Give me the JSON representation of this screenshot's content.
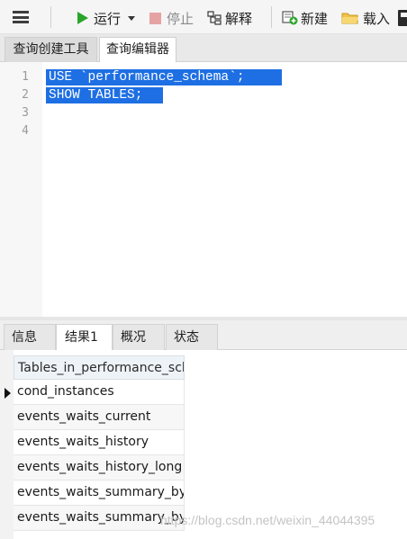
{
  "toolbar": {
    "menu_icon": "hamburger-menu-icon",
    "run_label": "运行",
    "stop_label": "停止",
    "explain_label": "解释",
    "new_label": "新建",
    "load_label": "载入"
  },
  "top_tabs": [
    {
      "label": "查询创建工具",
      "active": false
    },
    {
      "label": "查询编辑器",
      "active": true
    }
  ],
  "editor": {
    "line_numbers": [
      "1",
      "2",
      "3",
      "4"
    ],
    "lines": [
      "USE `performance_schema`;",
      "SHOW TABLES;"
    ],
    "selection_color": "#1e6fe3"
  },
  "result_tabs": [
    {
      "label": "信息",
      "active": false
    },
    {
      "label": "结果1",
      "active": true
    },
    {
      "label": "概况",
      "active": false
    },
    {
      "label": "状态",
      "active": false
    }
  ],
  "grid": {
    "column_header": "Tables_in_performance_schema",
    "rows": [
      "cond_instances",
      "events_waits_current",
      "events_waits_history",
      "events_waits_history_long",
      "events_waits_summary_by",
      "events_waits_summary_by"
    ],
    "selected_row": 0
  },
  "watermark": "https://blog.csdn.net/weixin_44044395",
  "colors": {
    "run_green": "#2aa52a",
    "stop_red": "#e6a3a3",
    "header_bg": "#eef3f8"
  }
}
